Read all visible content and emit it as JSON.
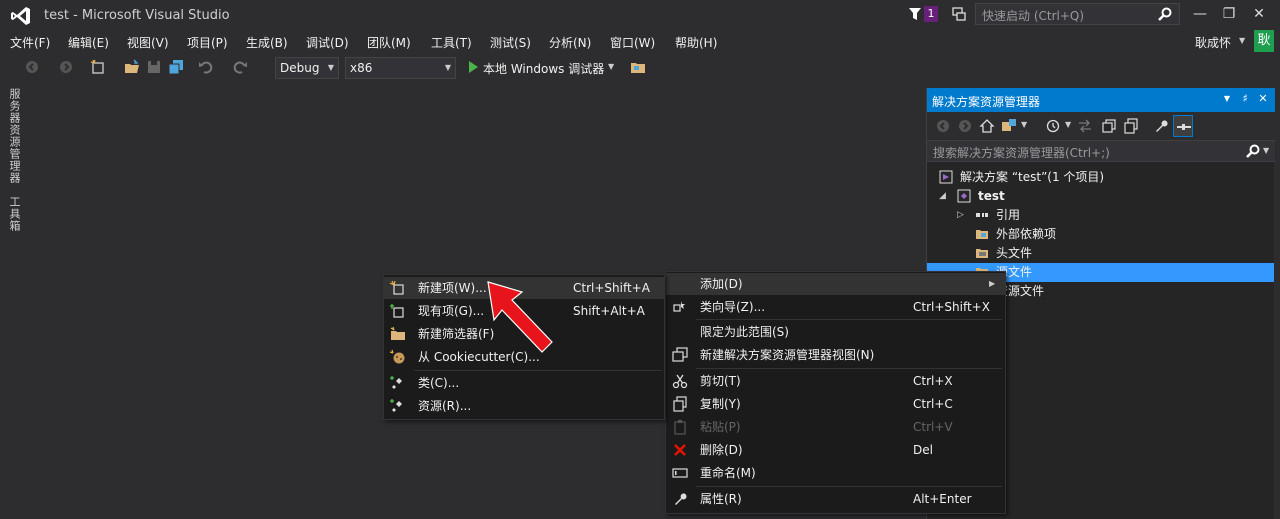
{
  "window": {
    "title": "test - Microsoft Visual Studio",
    "notification_count": "1",
    "quick_launch_placeholder": "快速启动 (Ctrl+Q)",
    "user": "耿成怀",
    "avatar_text": "耿",
    "accent": "#007acc"
  },
  "menu": [
    "文件(F)",
    "编辑(E)",
    "视图(V)",
    "项目(P)",
    "生成(B)",
    "调试(D)",
    "团队(M)",
    "工具(T)",
    "测试(S)",
    "分析(N)",
    "窗口(W)",
    "帮助(H)"
  ],
  "toolbar": {
    "config": "Debug",
    "platform": "x86",
    "run_label": "本地 Windows 调试器"
  },
  "left_tabs": [
    "服务器资源管理器",
    "工具箱"
  ],
  "solution_explorer": {
    "title": "解决方案资源管理器",
    "search_placeholder": "搜索解决方案资源管理器(Ctrl+;)",
    "tree": [
      {
        "label": "解决方案 “test”(1 个项目)",
        "icon": "solution-icon"
      },
      {
        "label": "test",
        "icon": "project-icon"
      },
      {
        "label": "引用",
        "icon": "references-icon"
      },
      {
        "label": "外部依赖项",
        "icon": "folder-icon"
      },
      {
        "label": "头文件",
        "icon": "folder-icon"
      },
      {
        "label": "源文件",
        "icon": "folder-icon",
        "selected": true
      },
      {
        "label": "资源文件",
        "icon": "folder-icon"
      }
    ]
  },
  "context_menu_main": {
    "items": [
      {
        "label": "添加(D)",
        "shortcut": "",
        "icon": "",
        "submenu": true
      },
      {
        "label": "类向导(Z)...",
        "shortcut": "Ctrl+Shift+X",
        "icon": "class-wizard-icon"
      },
      {
        "label": "限定为此范围(S)",
        "shortcut": "",
        "icon": ""
      },
      {
        "label": "新建解决方案资源管理器视图(N)",
        "shortcut": "",
        "icon": "new-view-icon"
      },
      {
        "label": "剪切(T)",
        "shortcut": "Ctrl+X",
        "icon": "cut-icon"
      },
      {
        "label": "复制(Y)",
        "shortcut": "Ctrl+C",
        "icon": "copy-icon"
      },
      {
        "label": "粘贴(P)",
        "shortcut": "Ctrl+V",
        "icon": "paste-icon",
        "disabled": true
      },
      {
        "label": "删除(D)",
        "shortcut": "Del",
        "icon": "delete-icon"
      },
      {
        "label": "重命名(M)",
        "shortcut": "",
        "icon": "rename-icon"
      },
      {
        "label": "属性(R)",
        "shortcut": "Alt+Enter",
        "icon": "wrench-icon"
      }
    ]
  },
  "context_menu_add": {
    "items": [
      {
        "label": "新建项(W)...",
        "shortcut": "Ctrl+Shift+A",
        "icon": "new-item-icon"
      },
      {
        "label": "现有项(G)...",
        "shortcut": "Shift+Alt+A",
        "icon": "existing-item-icon"
      },
      {
        "label": "新建筛选器(F)",
        "shortcut": "",
        "icon": "new-filter-icon"
      },
      {
        "label": "从 Cookiecutter(C)...",
        "shortcut": "",
        "icon": "cookiecutter-icon"
      },
      {
        "label": "类(C)...",
        "shortcut": "",
        "icon": "class-icon"
      },
      {
        "label": "资源(R)...",
        "shortcut": "",
        "icon": "resource-icon"
      }
    ]
  }
}
